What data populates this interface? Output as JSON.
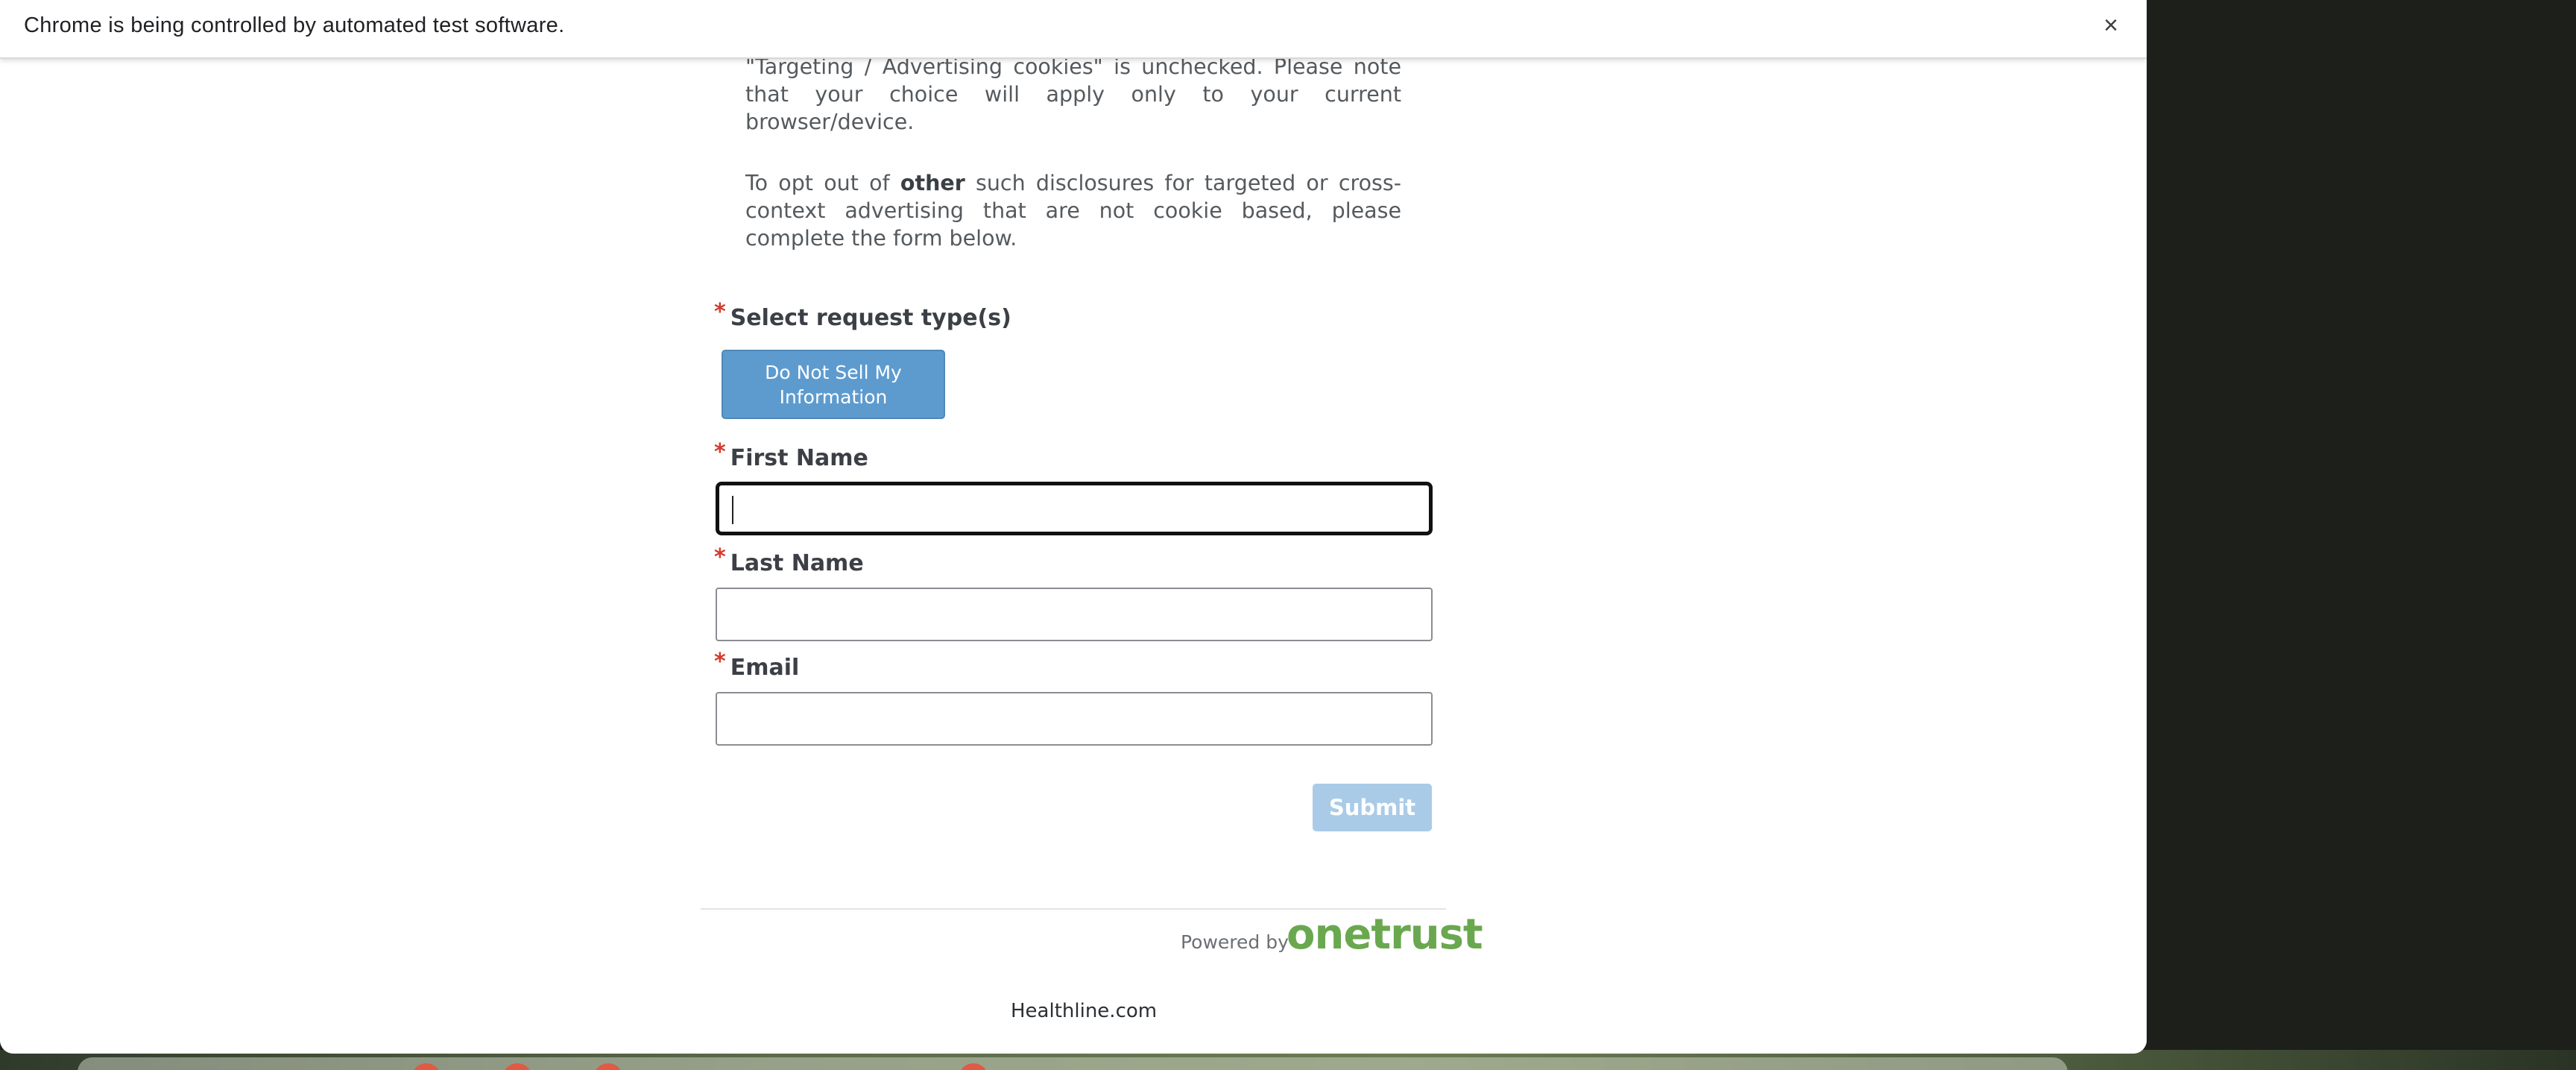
{
  "infobar": {
    "message": "Chrome is being controlled by automated test software.",
    "close_symbol": "×"
  },
  "intro": {
    "line_top": "footer of our website and checking that the category for \"Targeting / Advertising cookies\" is unchecked. Please note that your choice will apply only to your current browser/device.",
    "optout_pre": "To opt out of ",
    "optout_bold": "other",
    "optout_post": " such disclosures for targeted or cross-context advertising that are not cookie based, please complete the form below."
  },
  "form": {
    "required_marker": "*",
    "request_type_label": "Select request type(s)",
    "request_type_option": "Do Not Sell My Information",
    "first_name_label": "First Name",
    "first_name_value": "",
    "last_name_label": "Last Name",
    "last_name_value": "",
    "email_label": "Email",
    "email_value": "",
    "submit_label": "Submit"
  },
  "branding": {
    "powered_by": "Powered by",
    "logo_text": "onetrust",
    "logo_color": "#6aa84f"
  },
  "footer": {
    "site": "Healthline.com"
  },
  "colors": {
    "request_button": "#5d9bcf",
    "submit_button_disabled": "#a9cbe8",
    "required_star": "#d33a2c"
  }
}
